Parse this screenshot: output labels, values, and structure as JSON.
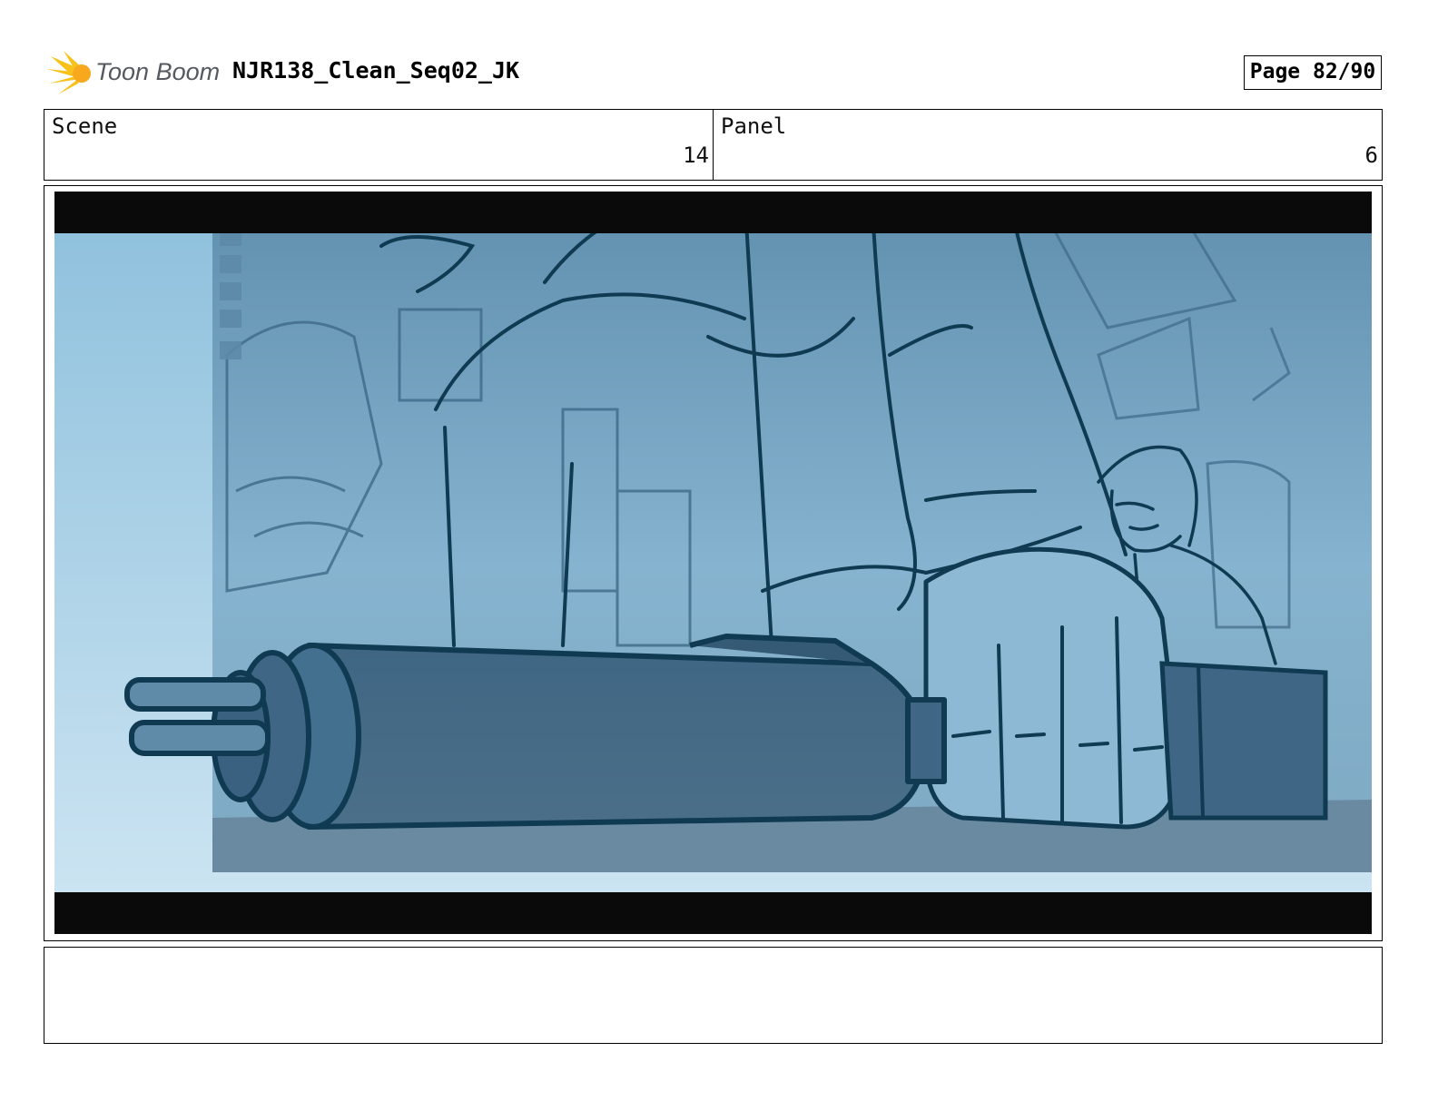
{
  "header": {
    "logo_text": "Toon Boom",
    "document_title": "NJR138_Clean_Seq02_JK",
    "page_label": "Page 82/90"
  },
  "info": {
    "scene_label": "Scene",
    "scene_value": "14",
    "panel_label": "Panel",
    "panel_value": "6"
  },
  "panel": {
    "icon": "storyboard-sketch-image",
    "tint_color": "#8fbfdc",
    "line_color": "#0f3a52"
  },
  "notes": {
    "text": ""
  }
}
